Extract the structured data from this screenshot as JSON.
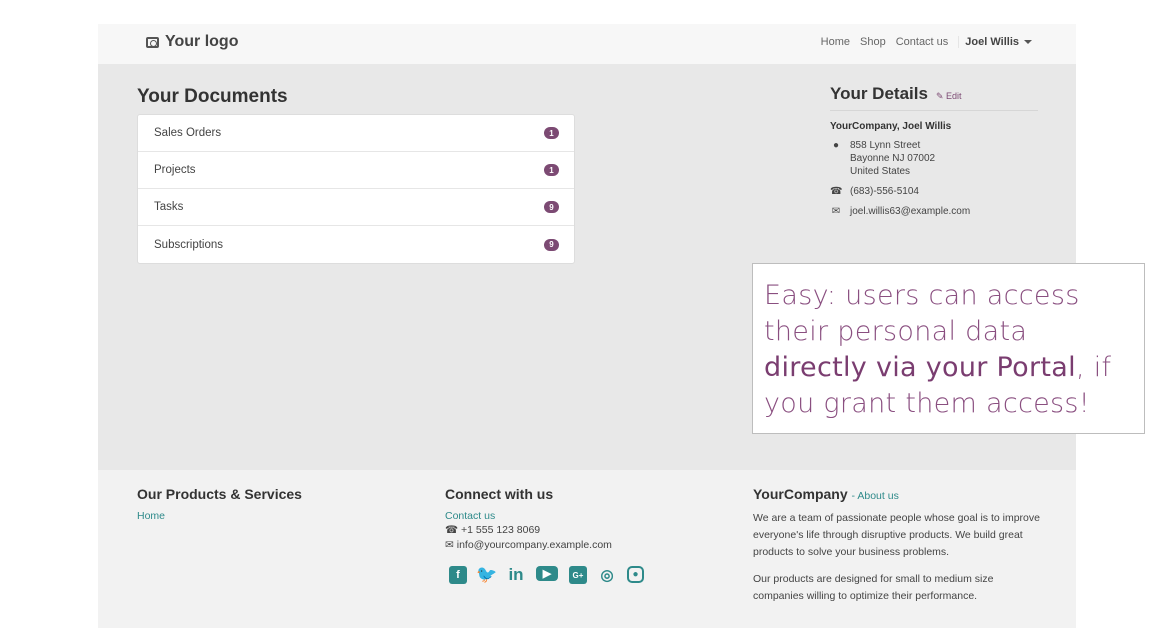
{
  "header": {
    "logo_text": "Your logo",
    "nav": [
      "Home",
      "Shop",
      "Contact us"
    ],
    "user": "Joel Willis"
  },
  "documents": {
    "title": "Your Documents",
    "items": [
      {
        "label": "Sales Orders",
        "count": "1"
      },
      {
        "label": "Projects",
        "count": "1"
      },
      {
        "label": "Tasks",
        "count": "9"
      },
      {
        "label": "Subscriptions",
        "count": "9"
      }
    ]
  },
  "details": {
    "title": "Your Details",
    "edit_label": "Edit",
    "company": "YourCompany, Joel Willis",
    "address_line1": "858 Lynn Street",
    "address_line2": "Bayonne NJ 07002",
    "address_line3": "United States",
    "phone": "(683)-556-5104",
    "email": "joel.willis63@example.com"
  },
  "callout": {
    "part1": "Easy: users can access their personal data ",
    "emphasis": "directly via your Portal",
    "part2": ", if you grant them access!"
  },
  "footer": {
    "products_title": "Our Products & Services",
    "products_link": "Home",
    "connect_title": "Connect with us",
    "connect_link": "Contact us",
    "phone": "+1 555 123 8069",
    "email": "info@yourcompany.example.com",
    "company_title": "YourCompany",
    "about_link": "About us",
    "about_text1": "We are a team of passionate people whose goal is to improve everyone's life through disruptive products. We build great products to solve your business problems.",
    "about_text2": "Our products are designed for small to medium size companies willing to optimize their performance.",
    "social_icons": [
      "facebook-icon",
      "twitter-icon",
      "linkedin-icon",
      "youtube-icon",
      "google-plus-icon",
      "github-icon",
      "instagram-icon"
    ]
  },
  "colors": {
    "brand": "#7c4a73",
    "link": "#2e8a8a"
  }
}
